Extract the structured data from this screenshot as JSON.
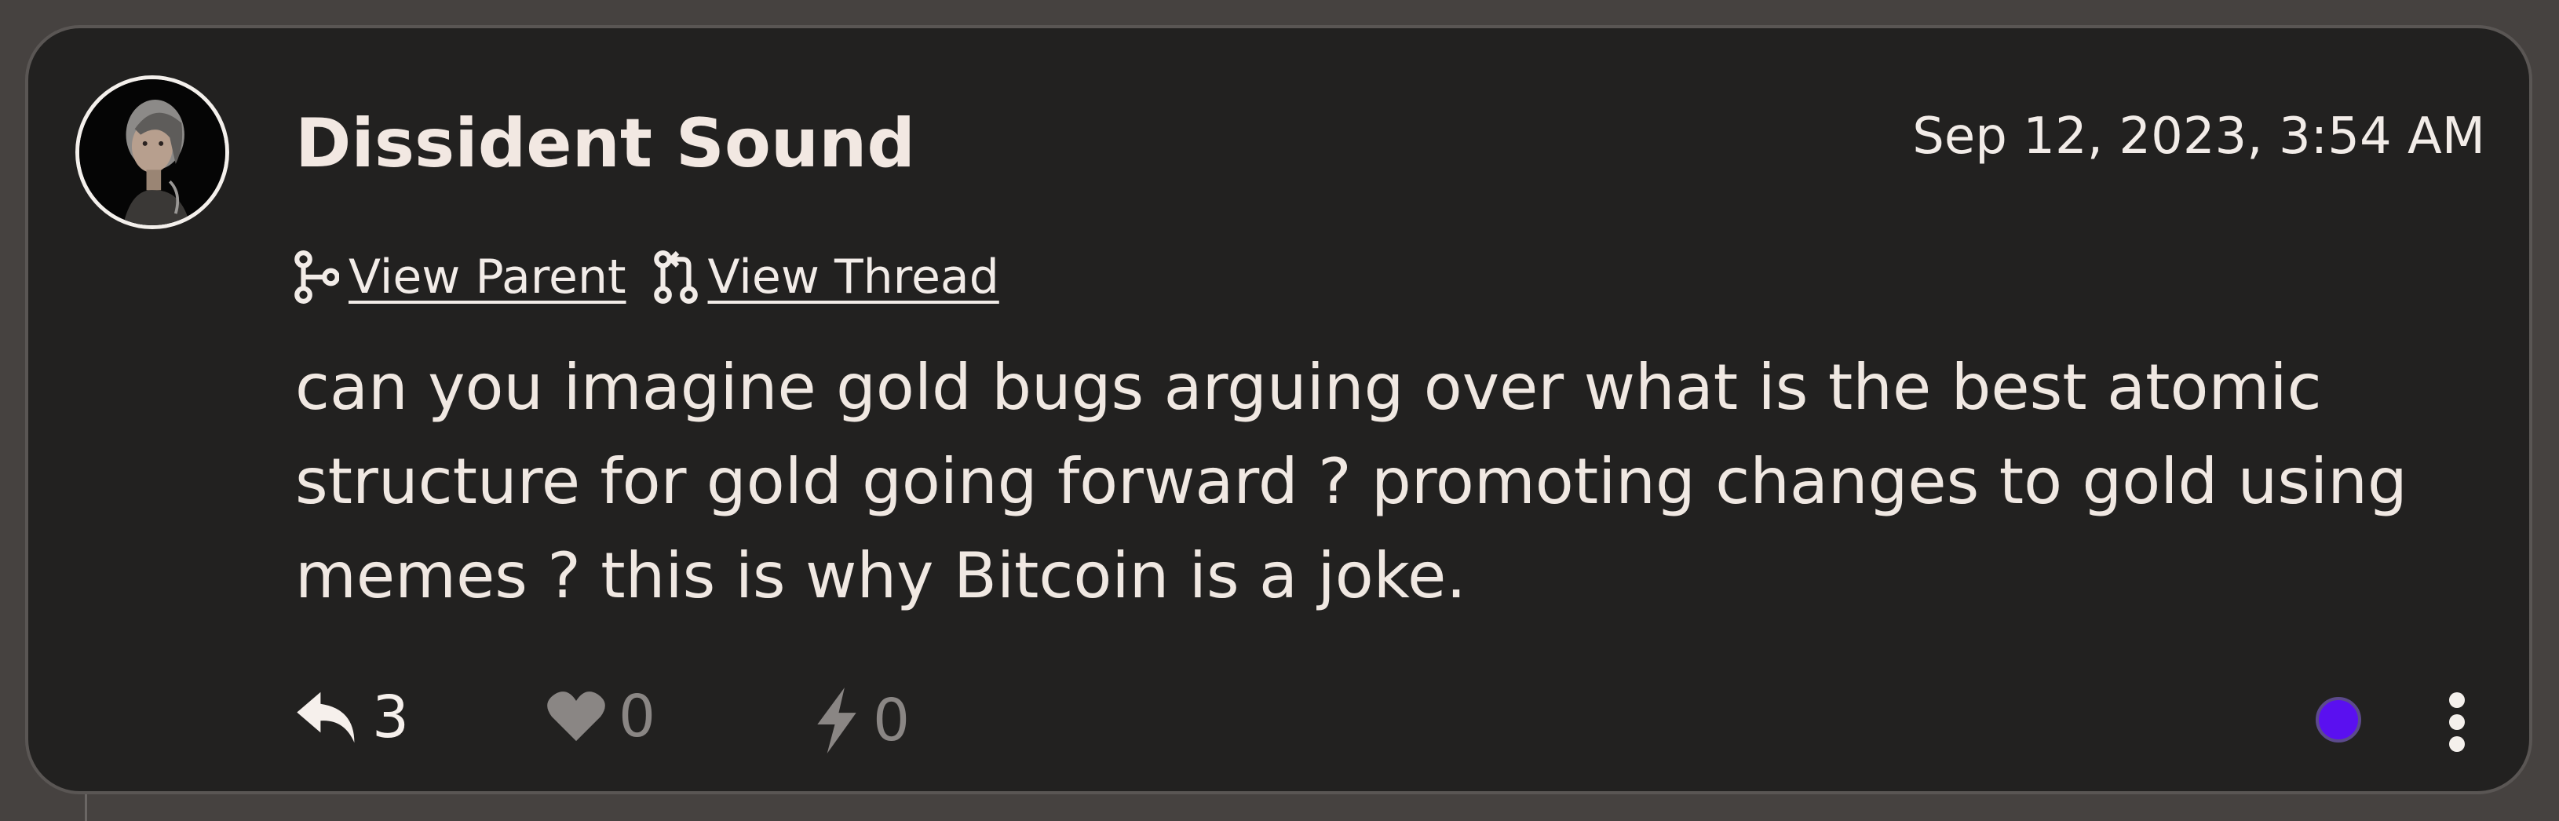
{
  "note": {
    "author": "Dissident Sound",
    "timestamp": "Sep 12, 2023, 3:54 AM",
    "links": {
      "view_parent": "View Parent",
      "view_thread": "View Thread"
    },
    "content": "can you imagine gold bugs arguing over what is the best atomic structure for gold going forward ? promoting changes to gold using memes ? this is why Bitcoin is a joke.",
    "actions": {
      "reply_count": "3",
      "like_count": "0",
      "zap_count": "0"
    },
    "status_color": "#5a10f0"
  },
  "icons": {
    "parent": "git-branch-icon",
    "thread": "git-pull-request-icon",
    "reply": "reply-arrow-icon",
    "like": "heart-icon",
    "zap": "lightning-bolt-icon",
    "more": "vertical-ellipsis-icon"
  },
  "colors": {
    "background": "#464240",
    "card": "#222120",
    "text": "#f2ece8",
    "muted": "#8a8684"
  }
}
